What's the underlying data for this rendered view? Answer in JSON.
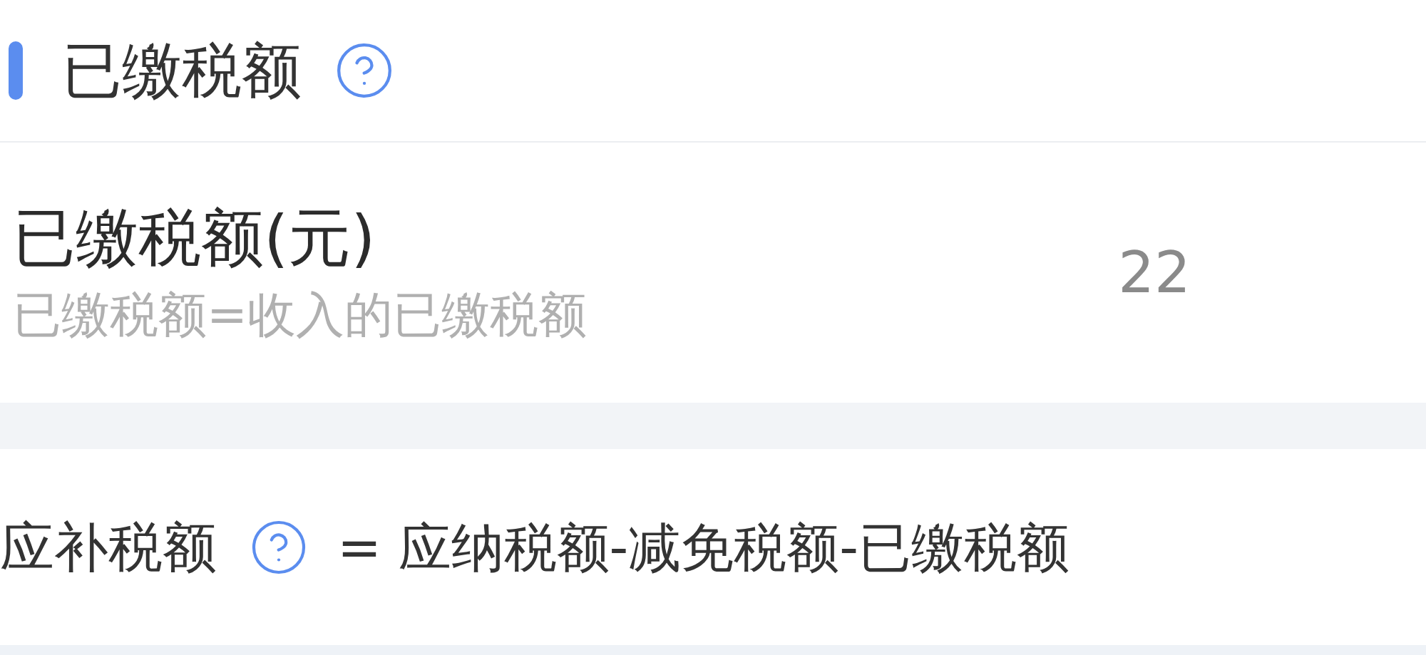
{
  "section": {
    "title": "已缴税额"
  },
  "row": {
    "label": "已缴税额(元)",
    "description": "已缴税额=收入的已缴税额",
    "value": "22"
  },
  "formula": {
    "label": "应补税额",
    "expression": "= 应纳税额-减免税额-已缴税额"
  }
}
